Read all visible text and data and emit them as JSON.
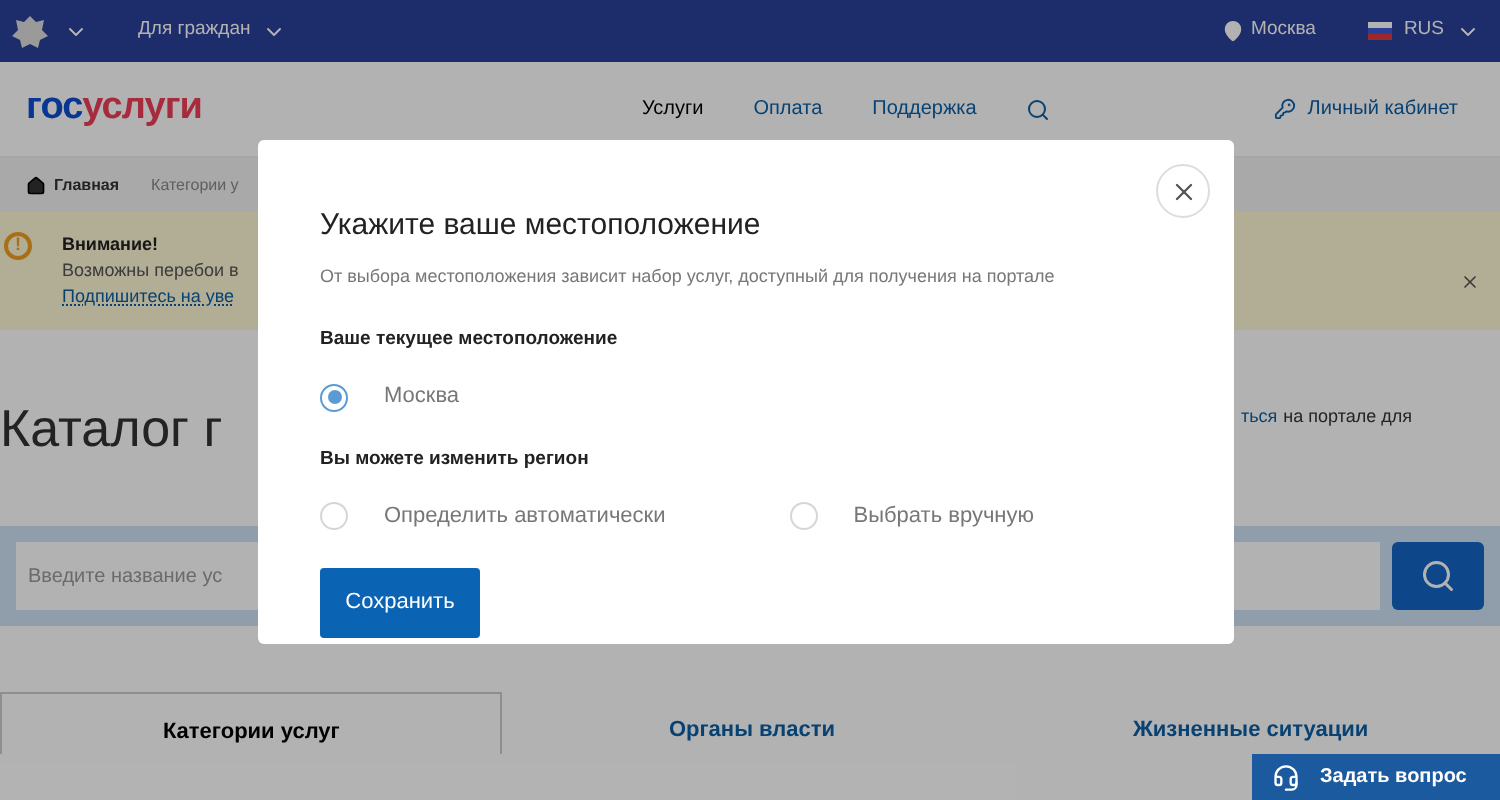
{
  "top_bar": {
    "audience": "Для граждан",
    "location": "Москва",
    "language": "RUS"
  },
  "header": {
    "logo_left": "гос",
    "logo_right": "услуги",
    "nav": [
      {
        "label": "Услуги",
        "selected": true
      },
      {
        "label": "Оплата",
        "selected": false
      },
      {
        "label": "Поддержка",
        "selected": false
      }
    ],
    "account": "Личный кабинет"
  },
  "breadcrumbs": [
    "Главная",
    "Категории у"
  ],
  "alert": {
    "warning_mark": "!",
    "title": "Внимание!",
    "text": "Возможны перебои в",
    "link": "Подпишитесь на уве"
  },
  "catalog": {
    "title": "Каталог г",
    "note_link": "ться",
    "note_text": "на портале для"
  },
  "search": {
    "placeholder": "Введите название ус"
  },
  "tabs": [
    {
      "label": "Категории услуг",
      "selected": true
    },
    {
      "label": "Органы власти",
      "selected": false
    },
    {
      "label": "Жизненные ситуации",
      "selected": false
    }
  ],
  "help_button": "Задать вопрос",
  "modal": {
    "title": "Укажите ваше местоположение",
    "subtitle": "От выбора местоположения зависит набор услуг, доступный для получения на портале",
    "current_heading": "Ваше текущее местоположение",
    "current": [
      {
        "label": "Москва",
        "selected": true
      }
    ],
    "change_heading": "Вы можете изменить регион",
    "options": [
      {
        "label": "Определить автоматически",
        "selected": false
      },
      {
        "label": "Выбрать вручную",
        "selected": false
      }
    ],
    "button": "Сохранить"
  }
}
